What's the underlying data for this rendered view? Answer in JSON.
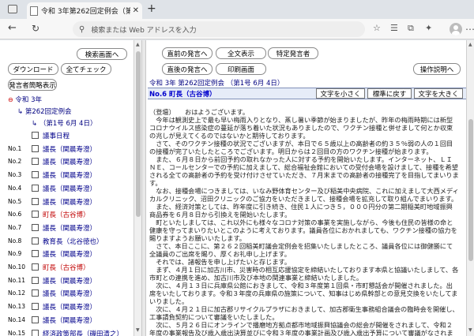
{
  "browser": {
    "tab_title": "令和 3年第262回定例会（第1号",
    "tab_close": "✕",
    "new_tab": "+",
    "address_placeholder": "検索または Web アドレスを入力",
    "back": "←",
    "reload": "↻",
    "menu": "⋯"
  },
  "left": {
    "buttons": {
      "search_screen": "検索画面へ",
      "download": "ダウンロード",
      "check_all": "全てチェック",
      "speaker_list": "発言者簡略表示"
    },
    "tree": {
      "era": "令和 3年",
      "session": "第262回定例会",
      "issue": "（第1号 6月 4日）",
      "minus": "⊖"
    },
    "rows": [
      {
        "num": "",
        "name": "議事日程",
        "red": false
      },
      {
        "num": "No.1",
        "name": "議長（関晨寿澄）",
        "red": false
      },
      {
        "num": "No.2",
        "name": "議長（関晨寿澄）",
        "red": false
      },
      {
        "num": "No.3",
        "name": "議長（関晨寿澄）",
        "red": false
      },
      {
        "num": "No.4",
        "name": "議長（関晨寿澄）",
        "red": false
      },
      {
        "num": "No.5",
        "name": "議長（関晨寿澄）",
        "red": false
      },
      {
        "num": "No.6",
        "name": "町長（古谷博）",
        "red": true
      },
      {
        "num": "No.7",
        "name": "議長（関晨寿澄）",
        "red": false
      },
      {
        "num": "No.8",
        "name": "教育長（北谷徳也）",
        "red": false
      },
      {
        "num": "No.9",
        "name": "議長（関晨寿澄）",
        "red": false
      },
      {
        "num": "No.10",
        "name": "町長（古谷博）",
        "red": true
      },
      {
        "num": "No.11",
        "name": "議長（関晨寿澄）",
        "red": false
      },
      {
        "num": "No.12",
        "name": "議長（関晨寿澄）",
        "red": false
      },
      {
        "num": "No.13",
        "name": "議長（関晨寿澄）",
        "red": false
      },
      {
        "num": "No.14",
        "name": "議長（関晨寿澄）",
        "red": false
      },
      {
        "num": "No.15",
        "name": "経済政策部長（磯田清之）",
        "red": false
      }
    ]
  },
  "right": {
    "buttons": {
      "prev_speech": "直前の発言へ",
      "full_text": "全文表示",
      "specific_speaker": "特定発言者",
      "next_speech": "直後の発言へ",
      "print_screen": "印刷画面",
      "help": "操作説明へ"
    },
    "meta": "令和 3年 第262回定例会 （第1号 6月 4日）",
    "speaker": "No.6 町長（古谷博）",
    "font_buttons": {
      "smaller": "文字を小さく",
      "standard": "標準に戻す",
      "larger": "文字を大きく"
    },
    "paragraphs": [
      "（登壇）　　おはようございます。",
      "　今年は観測史上で最も早い梅雨入りとなり、蒸し暑い季節が始まりましたが、昨年の梅雨時期には新型コロナウイルス感染症の蔓延が落ち着いた状況もありましたので、ワクチン接種と併せまして何とか収束の兆しが見えてくるのではないかと期待しております。",
      "　さて、そのワクチン接種の状況でございますが、本日で６５歳以上の高齢者の約３５％弱の人の１回目の接種が完了いたしたところでございます。明日からは２回目の方のワクチン接種が始まります。",
      "　また、６月８日から前回予約の取れなかった人に対する予約を開始いたします。インターネット、ＬＩＮＥ、コールセンターでの予約に加えまして、総合福祉会館においての受付会場を設けまして、接種を希望される全ての高齢者の予約を受け付けさせていただき、７月末までの高齢者の接種完了を目指してまいります。",
      "　なお、接種会場につきましては、いなみ野体育センター及び稲美中央病院、これに加えまして大西メディカルクリニック、沼田クリニックのご協力をいただきまして、接種会場を拡充して取り組んでまいります。",
      "　また、経済対策としては、昨年度に引き続き、住民１人につき５，０００円分の第二期稲美町地域振興商品券を６月８日から引換えを開始いたします。",
      "　町といたしましては、これ以外にも様々なコロナ対策の事業を実施しながら、今後も住民の皆様の命と健康を守ってまいりたいとこのように考えております。議員各位におかれましても、ワクチン接種の協力を賜りますようお願いいたします。",
      "　さて、本日ここに、第２６２回稲美町議会定例会を招集いたしましたところ、議員各位には御健勝にて全議員のご出席を賜り、厚くお礼申し上げます。",
      "　それでは、諸報告を申し上げたいと存じます。",
      "　まず、４月１日に加古川市、災害時の相互応援協定を締結いたしております本県と協議いたしまして、各市町との連携を進め、加古川市及び本地の関連事業と締結いたしました。",
      "　次に、４月１３日に兵庫県公館におきまして、令和３年度第１回県・市町懇話会が開催されました。出席をいたしております。令和３年度の兵庫県の施策について、知事はじめ県幹部との意見交換をいたしてまいりました。",
      "　次に、４月２１日に加古郡リサイクルプラザにおきまして、加古郡衛生事務組合議会の臨時会を開催し、工事請負契約について審議をいたしました。",
      "　次に、５月２６日にオンラインで播磨地方拠点都市地域振興協議会の総会が開催をされまして、令和２年度の事業報告及び歳入歳出決算並びに令和３年度の事業計画及び歳入歳出予算について審議がなされました。"
    ]
  }
}
